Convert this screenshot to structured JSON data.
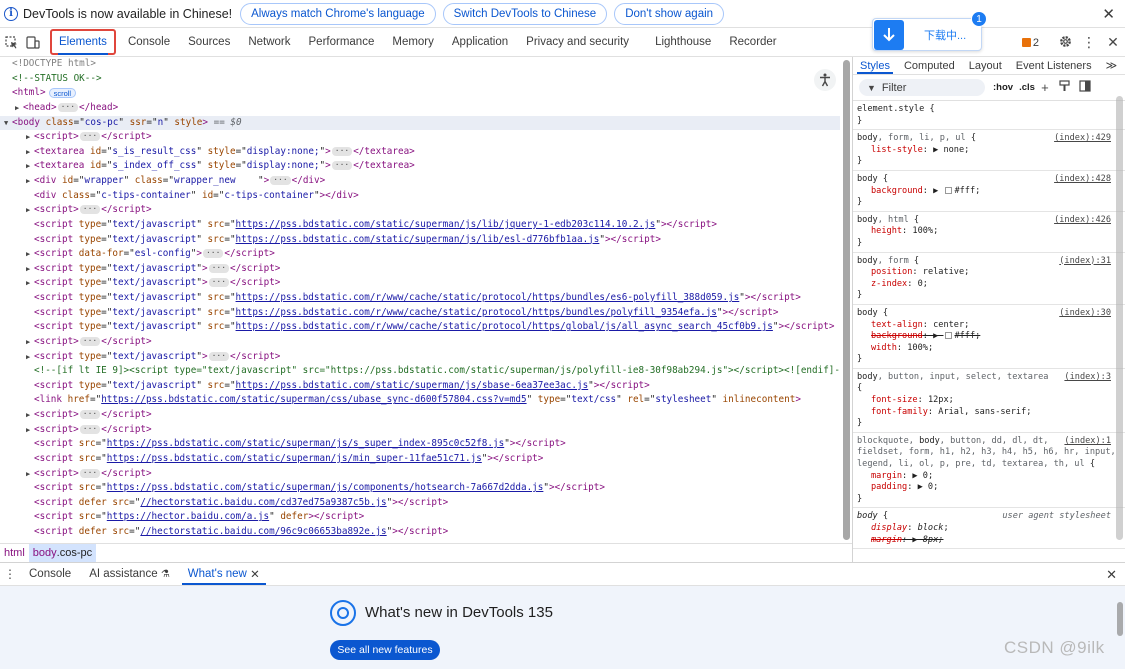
{
  "infobar": {
    "message": "DevTools is now available in Chinese!",
    "buttons": [
      "Always match Chrome's language",
      "Switch DevTools to Chinese",
      "Don't show again"
    ],
    "close": "✕"
  },
  "toolbar": {
    "tabs": [
      "Elements",
      "Console",
      "Sources",
      "Network",
      "Performance",
      "Memory",
      "Application",
      "Privacy and security",
      "Lighthouse",
      "Recorder"
    ],
    "issues_count": "2"
  },
  "download": {
    "text": "下载中...",
    "count": "1"
  },
  "dom": {
    "lines": [
      {
        "i": 0,
        "html": "<span class=\"dt\">&lt;!DOCTYPE html&gt;</span>"
      },
      {
        "i": 0,
        "html": "<span class=\"cm\">&lt;!--STATUS OK--&gt;</span>"
      },
      {
        "i": 0,
        "html": "<span class=\"t\">&lt;html&gt;</span><span class=\"badge\">scroll</span>"
      },
      {
        "i": 1,
        "tri": "▶",
        "html": "<span class=\"t\">&lt;head&gt;</span><span class=\"ell\">···</span><span class=\"t\">&lt;/head&gt;</span>"
      },
      {
        "i": 0,
        "tri": "▼",
        "sel": true,
        "html": "<span class=\"t\">&lt;body </span><span class=\"a\">class</span>=\"<span class=\"v\">cos-pc</span>\" <span class=\"a\">ssr</span>=\"<span class=\"v\">n</span>\" <span class=\"a\">style</span><span class=\"t\">&gt;</span> <span class=\"sel\">== $0</span>"
      },
      {
        "i": 2,
        "tri": "▶",
        "html": "<span class=\"t\">&lt;script&gt;</span><span class=\"ell\">···</span><span class=\"t\">&lt;/script&gt;</span>"
      },
      {
        "i": 2,
        "tri": "▶",
        "html": "<span class=\"t\">&lt;textarea </span><span class=\"a\">id</span>=\"<span class=\"v\">s_is_result_css</span>\" <span class=\"a\">style</span>=\"<span class=\"v\">display:none;</span>\"<span class=\"t\">&gt;</span><span class=\"ell\">···</span><span class=\"t\">&lt;/textarea&gt;</span>"
      },
      {
        "i": 2,
        "tri": "▶",
        "html": "<span class=\"t\">&lt;textarea </span><span class=\"a\">id</span>=\"<span class=\"v\">s_index_off_css</span>\" <span class=\"a\">style</span>=\"<span class=\"v\">display:none;</span>\"<span class=\"t\">&gt;</span><span class=\"ell\">···</span><span class=\"t\">&lt;/textarea&gt;</span>"
      },
      {
        "i": 2,
        "tri": "▶",
        "html": "<span class=\"t\">&lt;div </span><span class=\"a\">id</span>=\"<span class=\"v\">wrapper</span>\" <span class=\"a\">class</span>=\"<span class=\"v\">wrapper_new&nbsp;&nbsp;&nbsp;&nbsp;</span>\"<span class=\"t\">&gt;</span><span class=\"ell\">···</span><span class=\"t\">&lt;/div&gt;</span>"
      },
      {
        "i": 2,
        "html": "<span class=\"t\">&lt;div </span><span class=\"a\">class</span>=\"<span class=\"v\">c-tips-container</span>\" <span class=\"a\">id</span>=\"<span class=\"v\">c-tips-container</span>\"<span class=\"t\">&gt;&lt;/div&gt;</span>"
      },
      {
        "i": 2,
        "tri": "▶",
        "html": "<span class=\"t\">&lt;script&gt;</span><span class=\"ell\">···</span><span class=\"t\">&lt;/script&gt;</span>"
      },
      {
        "i": 2,
        "html": "<span class=\"t\">&lt;script </span><span class=\"a\">type</span>=\"<span class=\"v\">text/javascript</span>\" <span class=\"a\">src</span>=\"<span class=\"lnk\">https://pss.bdstatic.com/static/superman/js/lib/jquery-1-edb203c114.10.2.js</span>\"<span class=\"t\">&gt;&lt;/script&gt;</span>"
      },
      {
        "i": 2,
        "html": "<span class=\"t\">&lt;script </span><span class=\"a\">type</span>=\"<span class=\"v\">text/javascript</span>\" <span class=\"a\">src</span>=\"<span class=\"lnk\">https://pss.bdstatic.com/static/superman/js/lib/esl-d776bfb1aa.js</span>\"<span class=\"t\">&gt;&lt;/script&gt;</span>"
      },
      {
        "i": 2,
        "tri": "▶",
        "html": "<span class=\"t\">&lt;script </span><span class=\"a\">data-for</span>=\"<span class=\"v\">esl-config</span>\"<span class=\"t\">&gt;</span><span class=\"ell\">···</span><span class=\"t\">&lt;/script&gt;</span>"
      },
      {
        "i": 2,
        "tri": "▶",
        "html": "<span class=\"t\">&lt;script </span><span class=\"a\">type</span>=\"<span class=\"v\">text/javascript</span>\"<span class=\"t\">&gt;</span><span class=\"ell\">···</span><span class=\"t\">&lt;/script&gt;</span>"
      },
      {
        "i": 2,
        "tri": "▶",
        "html": "<span class=\"t\">&lt;script </span><span class=\"a\">type</span>=\"<span class=\"v\">text/javascript</span>\"<span class=\"t\">&gt;</span><span class=\"ell\">···</span><span class=\"t\">&lt;/script&gt;</span>"
      },
      {
        "i": 2,
        "html": "<span class=\"t\">&lt;script </span><span class=\"a\">type</span>=\"<span class=\"v\">text/javascript</span>\" <span class=\"a\">src</span>=\"<span class=\"lnk\">https://pss.bdstatic.com/r/www/cache/static/protocol/https/bundles/es6-polyfill_388d059.js</span>\"<span class=\"t\">&gt;&lt;/script&gt;</span>"
      },
      {
        "i": 2,
        "html": "<span class=\"t\">&lt;script </span><span class=\"a\">type</span>=\"<span class=\"v\">text/javascript</span>\" <span class=\"a\">src</span>=\"<span class=\"lnk\">https://pss.bdstatic.com/r/www/cache/static/protocol/https/bundles/polyfill_9354efa.js</span>\"<span class=\"t\">&gt;&lt;/script&gt;</span>"
      },
      {
        "i": 2,
        "html": "<span class=\"t\">&lt;script </span><span class=\"a\">type</span>=\"<span class=\"v\">text/javascript</span>\" <span class=\"a\">src</span>=\"<span class=\"lnk\">https://pss.bdstatic.com/r/www/cache/static/protocol/https/global/js/all_async_search_45cf0b9.js</span>\"<span class=\"t\">&gt;&lt;/script&gt;</span>"
      },
      {
        "i": 2,
        "tri": "▶",
        "html": "<span class=\"t\">&lt;script&gt;</span><span class=\"ell\">···</span><span class=\"t\">&lt;/script&gt;</span>"
      },
      {
        "i": 2,
        "tri": "▶",
        "html": "<span class=\"t\">&lt;script </span><span class=\"a\">type</span>=\"<span class=\"v\">text/javascript</span>\"<span class=\"t\">&gt;</span><span class=\"ell\">···</span><span class=\"t\">&lt;/script&gt;</span>"
      },
      {
        "i": 2,
        "html": "<span class=\"cm\">&lt;!--[if lt IE 9]&gt;&lt;script type=\"text/javascript\" src=\"https://pss.bdstatic.com/static/superman/js/polyfill-ie8-30f98ab294.js\"&gt;&lt;/script&gt;&lt;![endif]--&gt;</span>"
      },
      {
        "i": 2,
        "html": "<span class=\"t\">&lt;script </span><span class=\"a\">type</span>=\"<span class=\"v\">text/javascript</span>\" <span class=\"a\">src</span>=\"<span class=\"lnk\">https://pss.bdstatic.com/static/superman/js/sbase-6ea37ee3ac.js</span>\"<span class=\"t\">&gt;&lt;/script&gt;</span>"
      },
      {
        "i": 2,
        "html": "<span class=\"t\">&lt;link </span><span class=\"a\">href</span>=\"<span class=\"lnk\">https://pss.bdstatic.com/static/superman/css/ubase_sync-d600f57804.css?v=md5</span>\" <span class=\"a\">type</span>=\"<span class=\"v\">text/css</span>\" <span class=\"a\">rel</span>=\"<span class=\"v\">stylesheet</span>\" <span class=\"a\">inlinecontent</span><span class=\"t\">&gt;</span>"
      },
      {
        "i": 2,
        "tri": "▶",
        "html": "<span class=\"t\">&lt;script&gt;</span><span class=\"ell\">···</span><span class=\"t\">&lt;/script&gt;</span>"
      },
      {
        "i": 2,
        "tri": "▶",
        "html": "<span class=\"t\">&lt;script&gt;</span><span class=\"ell\">···</span><span class=\"t\">&lt;/script&gt;</span>"
      },
      {
        "i": 2,
        "html": "<span class=\"t\">&lt;script </span><span class=\"a\">src</span>=\"<span class=\"lnk\">https://pss.bdstatic.com/static/superman/js/s_super_index-895c0c52f8.js</span>\"<span class=\"t\">&gt;&lt;/script&gt;</span>"
      },
      {
        "i": 2,
        "html": "<span class=\"t\">&lt;script </span><span class=\"a\">src</span>=\"<span class=\"lnk\">https://pss.bdstatic.com/static/superman/js/min_super-11fae51c71.js</span>\"<span class=\"t\">&gt;&lt;/script&gt;</span>"
      },
      {
        "i": 2,
        "tri": "▶",
        "html": "<span class=\"t\">&lt;script&gt;</span><span class=\"ell\">···</span><span class=\"t\">&lt;/script&gt;</span>"
      },
      {
        "i": 2,
        "html": "<span class=\"t\">&lt;script </span><span class=\"a\">src</span>=\"<span class=\"lnk\">https://pss.bdstatic.com/static/superman/js/components/hotsearch-7a667d2dda.js</span>\"<span class=\"t\">&gt;&lt;/script&gt;</span>"
      },
      {
        "i": 2,
        "html": "<span class=\"t\">&lt;script </span><span class=\"a\">defer src</span>=\"<span class=\"lnk\">//hectorstatic.baidu.com/cd37ed75a9387c5b.js</span>\"<span class=\"t\">&gt;&lt;/script&gt;</span>"
      },
      {
        "i": 2,
        "html": "<span class=\"t\">&lt;script </span><span class=\"a\">src</span>=\"<span class=\"lnk\">https://hector.baidu.com/a.js</span>\" <span class=\"a\">defer</span><span class=\"t\">&gt;&lt;/script&gt;</span>"
      },
      {
        "i": 2,
        "html": "<span class=\"t\">&lt;script </span><span class=\"a\">defer src</span>=\"<span class=\"lnk\">//hectorstatic.baidu.com/96c9c06653ba892e.js</span>\"<span class=\"t\">&gt;&lt;/script&gt;</span>"
      }
    ]
  },
  "breadcrumb": {
    "root": "html",
    "current_tag": "body",
    "current_class": ".cos-pc"
  },
  "styles": {
    "tabs": [
      "Styles",
      "Computed",
      "Layout",
      "Event Listeners"
    ],
    "more": "≫",
    "filter_placeholder": "Filter",
    "hov": ":hov",
    "cls": ".cls",
    "rules": [
      {
        "sel": "<span class=\"sel-match\">element.style</span> {",
        "src": "",
        "props": [],
        "close": "}"
      },
      {
        "sel": "<span class=\"sel-match\">body</span><span class=\"sel-txt\">, form, li, p, ul</span> {",
        "src": "(index):429",
        "props": [
          "<span class=\"pn\">list-style</span>: ▶ <span class=\"pv\">none</span>;"
        ],
        "close": "}"
      },
      {
        "sel": "<span class=\"sel-match\">body</span> {",
        "src": "(index):428",
        "props": [
          "<span class=\"pn\">background</span>: ▶ <span class=\"swatch\"></span><span class=\"pv\">#fff</span>;"
        ],
        "close": "}"
      },
      {
        "sel": "<span class=\"sel-match\">body</span><span class=\"sel-txt\">, html</span> {",
        "src": "(index):426",
        "props": [
          "<span class=\"pn\">height</span>: <span class=\"pv\">100%</span>;"
        ],
        "close": "}"
      },
      {
        "sel": "<span class=\"sel-match\">body</span><span class=\"sel-txt\">, form</span> {",
        "src": "(index):31",
        "props": [
          "<span class=\"pn\">position</span>: <span class=\"pv\">relative</span>;",
          "<span class=\"pn\">z-index</span>: <span class=\"pv\">0</span>;"
        ],
        "close": "}"
      },
      {
        "sel": "<span class=\"sel-match\">body</span> {",
        "src": "(index):30",
        "props": [
          "<span class=\"pn\">text-align</span>: <span class=\"pv\">center</span>;",
          "<span class=\"pn strike\">background</span><span class=\"strike\">: ▶ <span class=\"swatch\"></span>#fff;</span>",
          "<span class=\"pn\">width</span>: <span class=\"pv\">100%</span>;"
        ],
        "close": "}"
      },
      {
        "sel": "<span class=\"sel-match\">body</span><span class=\"sel-txt\">, button, input, select, textarea</span>",
        "src": "(index):3",
        "pre": "{",
        "props": [
          "<span class=\"pn\">font-size</span>: <span class=\"pv\">12px</span>;",
          "<span class=\"pn\">font-family</span>: <span class=\"pv\">Arial, sans-serif</span>;"
        ],
        "close": "}"
      },
      {
        "sel": "<span class=\"sel-txt\">blockquote, </span><span class=\"sel-match\">body</span><span class=\"sel-txt\">, button, dd, dl, dt,</span>",
        "src": "(index):1",
        "extra": [
          "<span class=\"sel-txt\">fieldset, form, h1, h2, h3, h4, h5, h6, hr, input,</span>",
          "<span class=\"sel-txt\">legend, li, ol, p, pre, td, textarea, th, ul</span> {"
        ],
        "props": [
          "<span class=\"pn\">margin</span>: ▶ <span class=\"pv\">0</span>;",
          "<span class=\"pn\">padding</span>: ▶ <span class=\"pv\">0</span>;"
        ],
        "close": "}"
      },
      {
        "sel": "<i class=\"sel-match\">body</i> {",
        "src": "user agent stylesheet",
        "ua": true,
        "props": [
          "<i class=\"pn\">display</i>: <i class=\"pv\">block</i>;",
          "<i class=\"pn strike\">margin</i><i class=\"strike\">: ▶ 8px;</i>"
        ],
        "close": ""
      }
    ]
  },
  "drawer": {
    "tabs": [
      "Console",
      "AI assistance",
      "What's new"
    ],
    "whats_new_title": "What's new in DevTools 135",
    "see_all": "See all new features"
  },
  "watermark": "CSDN @9ilk"
}
